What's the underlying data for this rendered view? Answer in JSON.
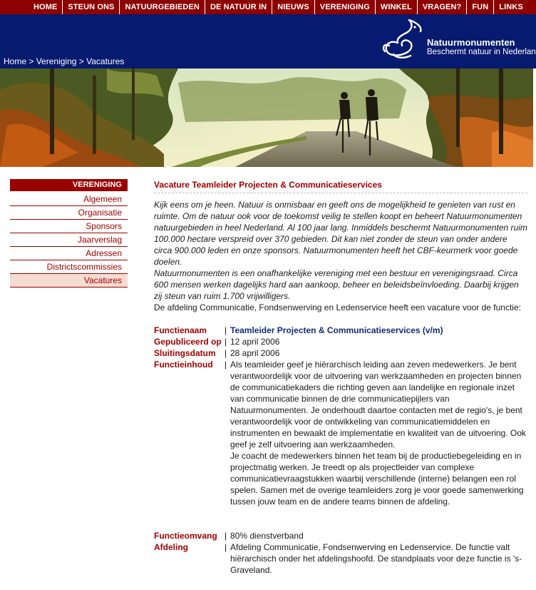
{
  "nav": {
    "items": [
      "HOME",
      "STEUN ONS",
      "NATUURGEBIEDEN",
      "DE NATUUR IN",
      "NIEUWS",
      "VERENIGING",
      "WINKEL",
      "VRAGEN?",
      "FUN",
      "LINKS"
    ]
  },
  "breadcrumb": {
    "home": "Home",
    "sep1": " > ",
    "section": "Vereniging",
    "sep2": " > ",
    "current": "Vacatures"
  },
  "logo": {
    "name": "Natuurmonumenten",
    "tagline": "Beschermt natuur in Nederland"
  },
  "sidebar": {
    "heading": "VERENIGING",
    "items": [
      "Algemeen",
      "Organisatie",
      "Sponsors",
      "Jaarverslag",
      "Adressen",
      "Districtscommissies",
      "Vacatures"
    ],
    "active": "Vacatures"
  },
  "main": {
    "title": "Vacature Teamleider Projecten & Communicatieservices",
    "intro_1": "Kijk eens om je heen. Natuur is onmisbaar en geeft ons de mogelijkheid te genieten van rust en ruimte. Om de natuur ook voor de toekomst veilig te stellen koopt en beheert Natuurmonumenten natuurgebieden in heel Nederland. Al 100 jaar lang. Inmiddels beschermt Natuurmonumenten ruim 100.000 hectare verspreid over 370 gebieden. Dit kan niet zonder de steun van onder andere circa 900.000 leden en onze sponsors. Natuurmonumenten heeft het CBF-keurmerk voor goede doelen.",
    "intro_2": "Natuurmonumenten is een onafhankelijke vereniging met een bestuur en verenigingsraad. Circa 600 mensen werken dagelijks hard aan aankoop, beheer en beleidsbeïnvloeding. Daarbij krijgen zij steun van ruim 1.700 vrijwilligers.",
    "lead": "De afdeling Communicatie, Fondsenwerving en Ledenservice heeft een vacature voor de functie:",
    "fields": {
      "functienaam": {
        "label": "Functienaam",
        "value": "Teamleider Projecten & Communicatieservices (v/m)"
      },
      "gepubliceerd": {
        "label": "Gepubliceerd op",
        "value": "12 april 2006"
      },
      "sluitingsdatum": {
        "label": "Sluitingsdatum",
        "value": "28 april 2006"
      },
      "functieinhoud": {
        "label": "Functieinhoud",
        "value_1": "Als teamleider geef je hiërarchisch leiding aan zeven medewerkers. Je bent verantwoordelijk voor de uitvoering van werkzaamheden en projecten binnen de communicatiekaders die richting geven aan landelijke en regionale inzet van communicatie binnen de drie communicatiepijlers van Natuurmonumenten. Je onderhoudt daartoe contacten met de regio's, je bent verantwoordelijk voor de ontwikkeling van communicatiemiddelen en instrumenten en bewaakt de implementatie en kwaliteit van de uitvoering. Ook geef je zelf uitvoering aan werkzaamheden.",
        "value_2": "Je coacht de medewerkers binnen het team bij de productiebegeleiding en in projectmatig werken. Je treedt op als projectleider van complexe communicatievraagstukken waarbij verschillende (interne) belangen een rol spelen. Samen met de overige teamleiders zorg je voor goede samenwerking tussen jouw team en de andere teams binnen de afdeling."
      },
      "functieomvang": {
        "label": "Functieomvang",
        "value": "80% dienstverband"
      },
      "afdeling": {
        "label": "Afdeling",
        "value": "Afdeling Communicatie, Fondsenwerving en Ledenservice. De functie valt hiërarchisch onder het afdelingshoofd. De standplaats voor deze functie is 's-Graveland."
      }
    },
    "separator": "|"
  },
  "colors": {
    "nav_bg": "#8c0000",
    "header_bg": "#061a70",
    "label_red": "#a00000",
    "title_blue": "#142a78"
  }
}
